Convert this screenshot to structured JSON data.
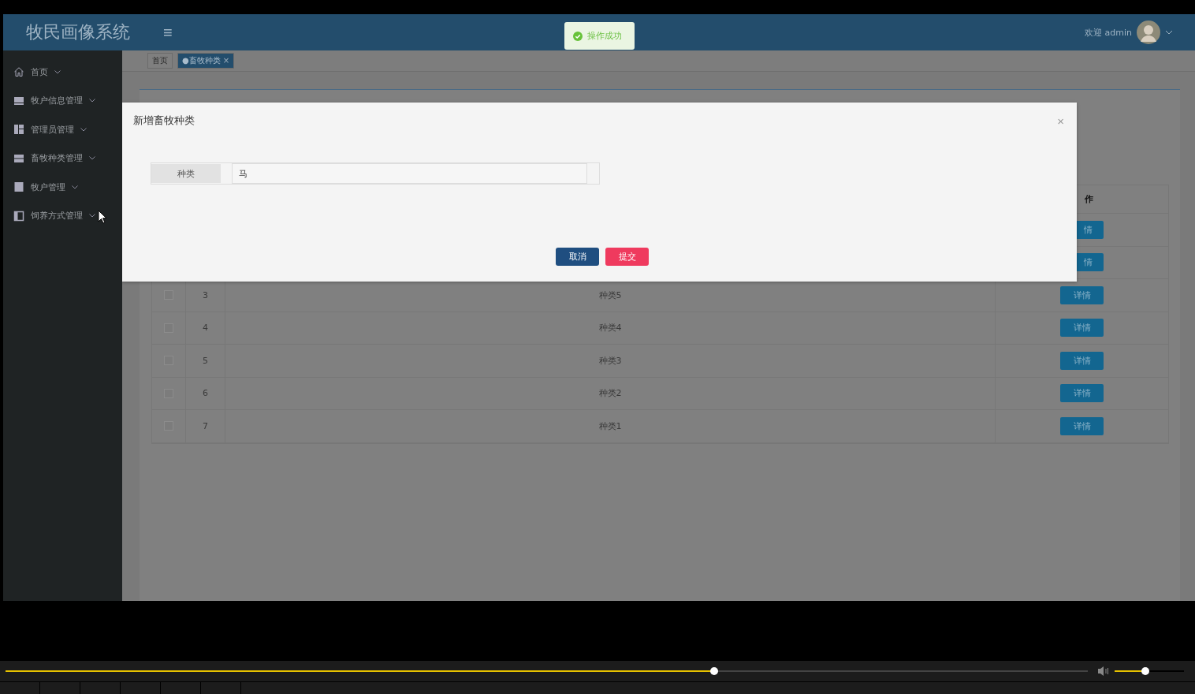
{
  "app": {
    "logo": "牧民画像系统",
    "menu_glyph": "≡",
    "toast": "操作成功",
    "welcome": "欢迎 admin"
  },
  "sidebar": {
    "items": [
      {
        "label": "首页"
      },
      {
        "label": "牧户信息管理"
      },
      {
        "label": "管理员管理"
      },
      {
        "label": "畜牧种类管理"
      },
      {
        "label": "牧户管理"
      },
      {
        "label": "饲养方式管理"
      }
    ]
  },
  "tabs": [
    {
      "label": "首页",
      "selected": false
    },
    {
      "label": "●畜牧种类",
      "selected": true,
      "close_glyph": "×"
    }
  ],
  "table": {
    "action_header": "作",
    "covered_actions": [
      "情",
      "情"
    ],
    "rows": [
      {
        "index": "3",
        "name": "种类5",
        "action": "详情",
        "checked": false
      },
      {
        "index": "4",
        "name": "种类4",
        "action": "详情",
        "checked": false
      },
      {
        "index": "5",
        "name": "种类3",
        "action": "详情",
        "checked": false
      },
      {
        "index": "6",
        "name": "种类2",
        "action": "详情",
        "checked": false
      },
      {
        "index": "7",
        "name": "种类1",
        "action": "详情",
        "checked": false
      }
    ]
  },
  "dialog": {
    "title": "新增畜牧种类",
    "close_glyph": "×",
    "field_label": "种类",
    "field_value": "马",
    "buttons": [
      {
        "label": "取消",
        "kind": "cancel"
      },
      {
        "label": "提交",
        "kind": "submit"
      }
    ]
  },
  "player": {
    "progress": {
      "level": 0.655
    },
    "volume": {
      "level": 0.44
    }
  }
}
